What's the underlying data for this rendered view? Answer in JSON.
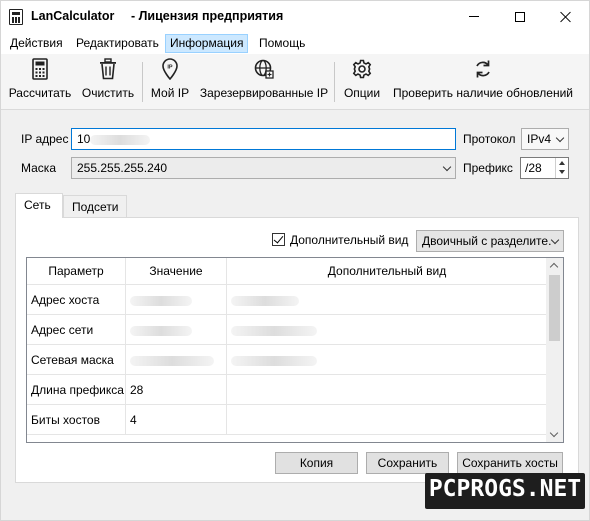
{
  "window": {
    "app_name": "LanCalculator",
    "license": "- Лицензия предприятия"
  },
  "menu": {
    "items": [
      "Действия",
      "Редактировать",
      "Информация",
      "Помощь"
    ],
    "active": "Информация"
  },
  "toolbar": {
    "calculate": "Рассчитать",
    "clear": "Очистить",
    "my_ip": "Мой IP",
    "reserved_ip": "Зарезервированные IP",
    "options": "Опции",
    "check_updates": "Проверить наличие обновлений"
  },
  "form": {
    "ip_label": "IP адрес",
    "ip_value": "10",
    "mask_label": "Маска",
    "mask_value": "255.255.255.240",
    "protocol_label": "Протокол",
    "protocol_value": "IPv4",
    "prefix_label": "Префикс",
    "prefix_value": "/28"
  },
  "tabs": [
    "Сеть",
    "Подсети"
  ],
  "active_tab": "Сеть",
  "panel": {
    "extra_view_checkbox": "Дополнительный вид",
    "extra_view_checked": true,
    "view_mode": "Двоичный с разделите."
  },
  "table": {
    "headers": [
      "Параметр",
      "Значение",
      "Дополнительный вид"
    ],
    "rows": [
      {
        "param": "Адрес хоста",
        "value": "",
        "extra": ""
      },
      {
        "param": "Адрес сети",
        "value": "",
        "extra": ""
      },
      {
        "param": "Сетевая маска",
        "value": "",
        "extra": ""
      },
      {
        "param": "Длина префикса",
        "value": "28",
        "extra": ""
      },
      {
        "param": "Биты хостов",
        "value": "4",
        "extra": ""
      }
    ]
  },
  "buttons": {
    "copy": "Копия",
    "save": "Сохранить",
    "save_hosts": "Сохранить хосты"
  },
  "watermark": "PCPROGS.NET",
  "colors": {
    "accent": "#0078d7",
    "menu_active_bg": "#cce8ff"
  }
}
